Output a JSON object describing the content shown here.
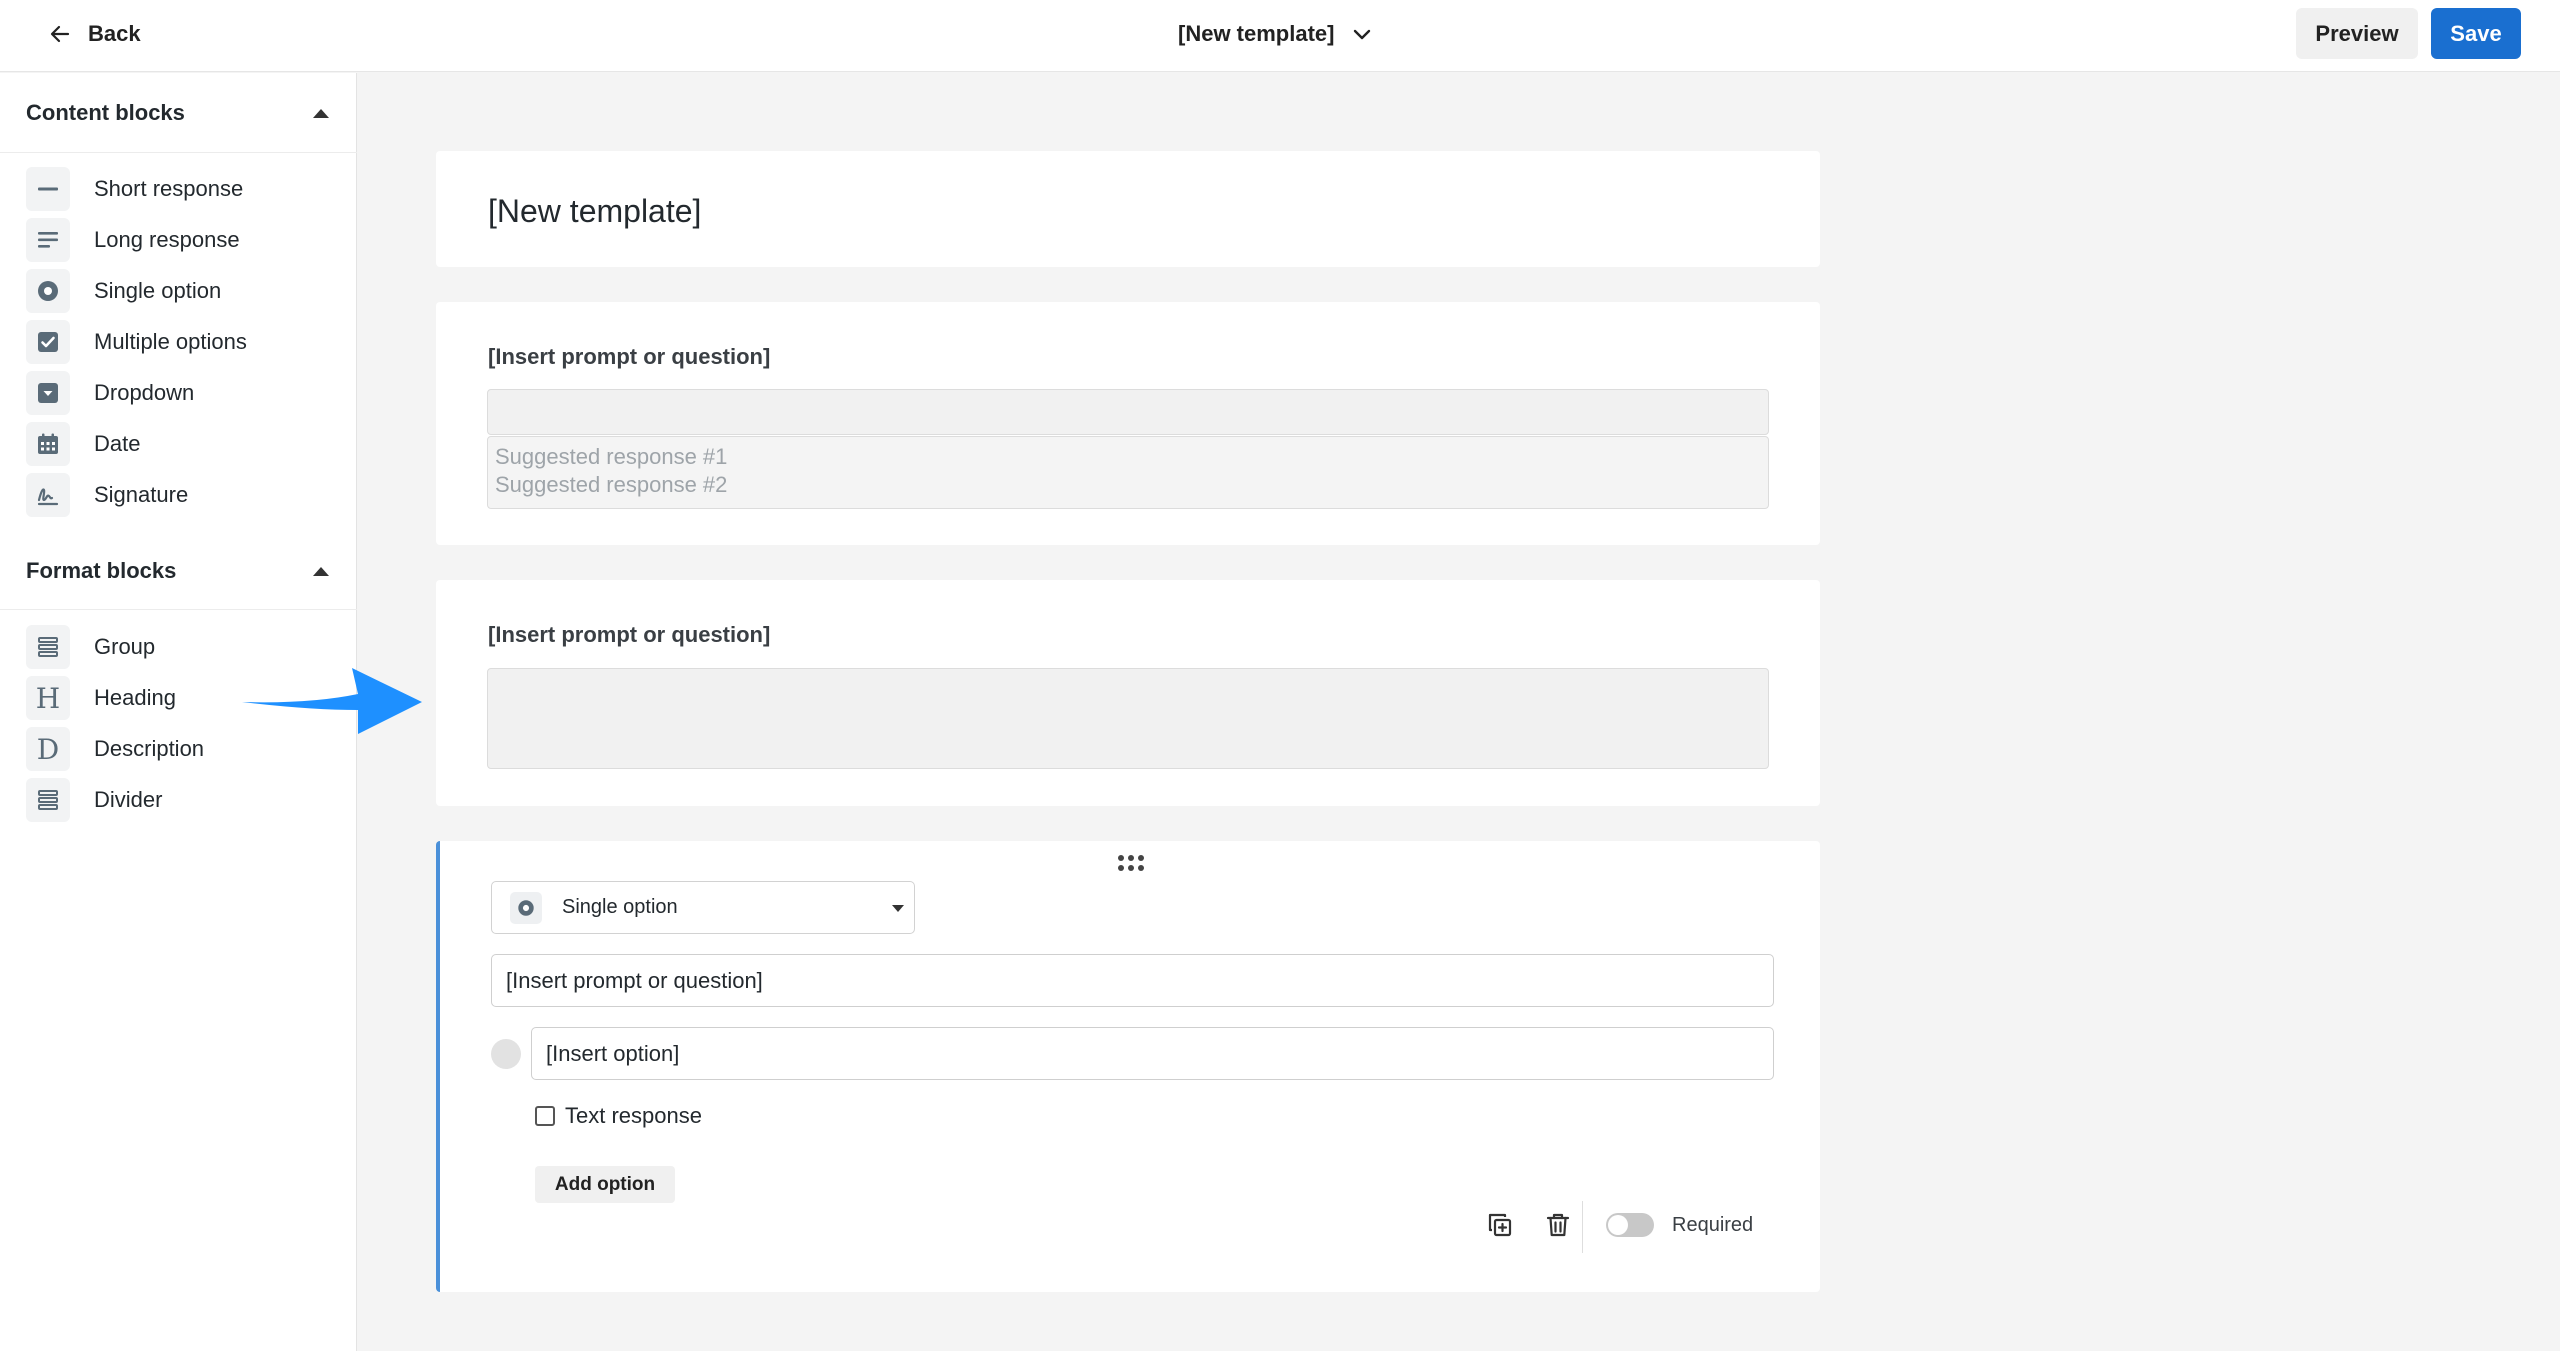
{
  "topbar": {
    "back_label": "Back",
    "template_title": "[New template]",
    "preview_label": "Preview",
    "save_label": "Save"
  },
  "colors": {
    "primary": "#1a6fd0",
    "arrow": "#1e90ff",
    "active_border": "#4a90d9"
  },
  "sidebar": {
    "content_blocks": {
      "title": "Content blocks",
      "items": [
        {
          "label": "Short response",
          "icon": "short-response-icon"
        },
        {
          "label": "Long response",
          "icon": "long-response-icon"
        },
        {
          "label": "Single option",
          "icon": "radio-icon"
        },
        {
          "label": "Multiple options",
          "icon": "checkbox-icon"
        },
        {
          "label": "Dropdown",
          "icon": "dropdown-icon"
        },
        {
          "label": "Date",
          "icon": "calendar-icon"
        },
        {
          "label": "Signature",
          "icon": "signature-icon"
        }
      ]
    },
    "format_blocks": {
      "title": "Format blocks",
      "items": [
        {
          "label": "Group",
          "icon": "group-icon"
        },
        {
          "label": "Heading",
          "icon": "heading-icon",
          "glyph": "H"
        },
        {
          "label": "Description",
          "icon": "description-icon",
          "glyph": "D"
        },
        {
          "label": "Divider",
          "icon": "divider-icon"
        }
      ]
    }
  },
  "canvas": {
    "title_card": {
      "title": "[New template]"
    },
    "short_card": {
      "prompt": "[Insert prompt or question]",
      "suggestions": [
        "Suggested response #1",
        "Suggested response #2"
      ]
    },
    "long_card": {
      "prompt": "[Insert prompt or question]"
    },
    "active_card": {
      "type_label": "Single option",
      "prompt_value": "[Insert prompt or question]",
      "option_value": "[Insert option]",
      "text_response_label": "Text response",
      "add_option_label": "Add option",
      "required_label": "Required",
      "required_on": false
    }
  }
}
